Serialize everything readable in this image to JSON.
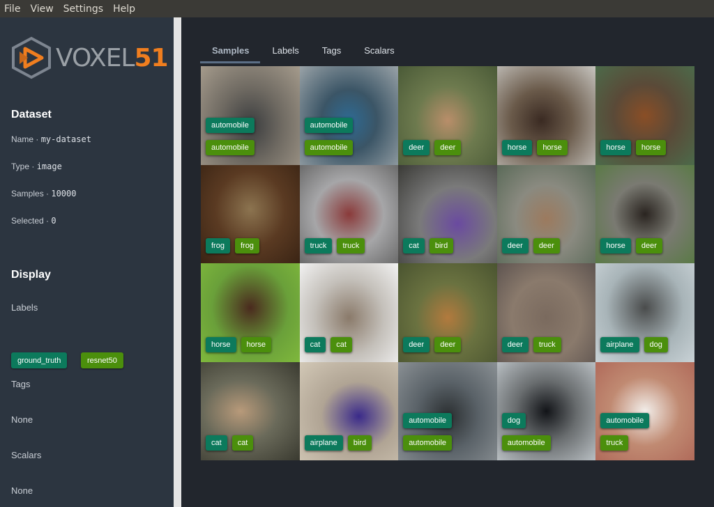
{
  "menu": [
    "File",
    "View",
    "Settings",
    "Help"
  ],
  "logo": {
    "text_a": "VOXEL",
    "text_b": "51"
  },
  "dataset": {
    "title": "Dataset",
    "name_key": "Name",
    "name_val": "my-dataset",
    "type_key": "Type",
    "type_val": "image",
    "samples_key": "Samples",
    "samples_val": "10000",
    "selected_key": "Selected",
    "selected_val": "0"
  },
  "display": {
    "title": "Display",
    "labels_title": "Labels",
    "label_fields": [
      "ground_truth",
      "resnet50"
    ],
    "tags_title": "Tags",
    "tags_value": "None",
    "scalars_title": "Scalars",
    "scalars_value": "None"
  },
  "tabs": [
    "Samples",
    "Labels",
    "Tags",
    "Scalars"
  ],
  "colors": {
    "ground_truth": "#0c7a5c",
    "resnet50": "#4b8f0c",
    "brand_orange": "#f07e1f"
  },
  "samples": [
    {
      "gt": "automobile",
      "pred": "automobile",
      "stacked": true
    },
    {
      "gt": "automobile",
      "pred": "automobile",
      "stacked": true
    },
    {
      "gt": "deer",
      "pred": "deer",
      "stacked": false
    },
    {
      "gt": "horse",
      "pred": "horse",
      "stacked": false
    },
    {
      "gt": "horse",
      "pred": "horse",
      "stacked": false
    },
    {
      "gt": "frog",
      "pred": "frog",
      "stacked": false
    },
    {
      "gt": "truck",
      "pred": "truck",
      "stacked": false
    },
    {
      "gt": "cat",
      "pred": "bird",
      "stacked": false
    },
    {
      "gt": "deer",
      "pred": "deer",
      "stacked": false
    },
    {
      "gt": "horse",
      "pred": "deer",
      "stacked": false
    },
    {
      "gt": "horse",
      "pred": "horse",
      "stacked": false
    },
    {
      "gt": "cat",
      "pred": "cat",
      "stacked": false
    },
    {
      "gt": "deer",
      "pred": "deer",
      "stacked": false
    },
    {
      "gt": "deer",
      "pred": "truck",
      "stacked": false
    },
    {
      "gt": "airplane",
      "pred": "dog",
      "stacked": false
    },
    {
      "gt": "cat",
      "pred": "cat",
      "stacked": false
    },
    {
      "gt": "airplane",
      "pred": "bird",
      "stacked": false
    },
    {
      "gt": "automobile",
      "pred": "automobile",
      "stacked": true
    },
    {
      "gt": "dog",
      "pred": "automobile",
      "stacked": true
    },
    {
      "gt": "automobile",
      "pred": "truck",
      "stacked": true
    }
  ]
}
